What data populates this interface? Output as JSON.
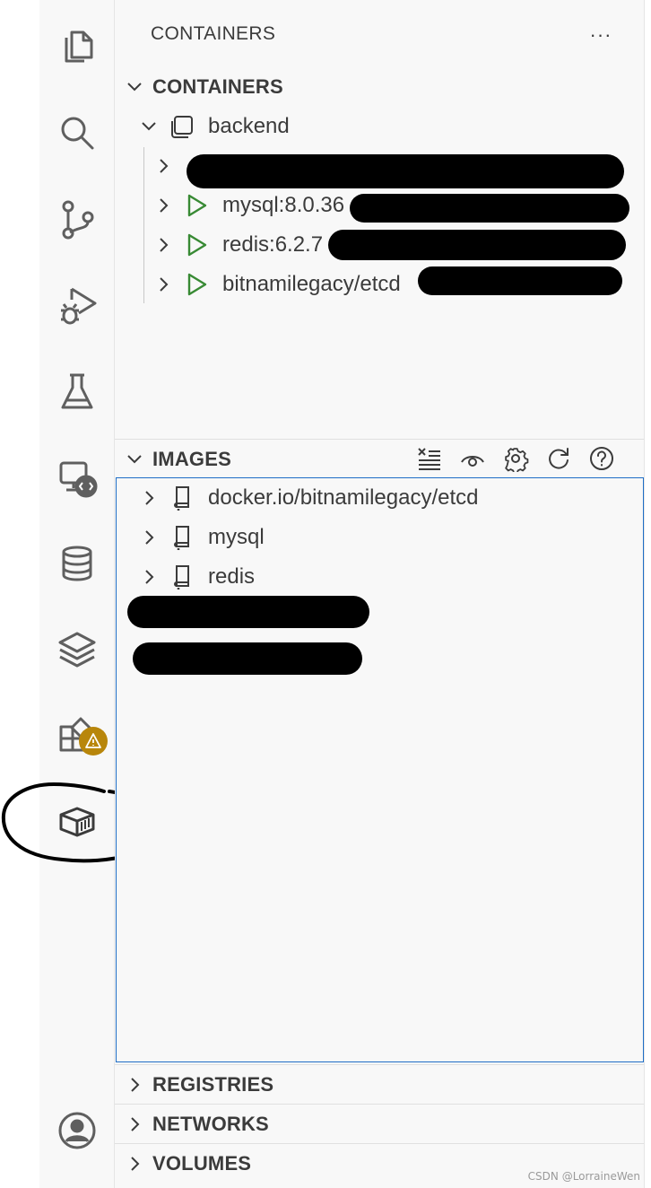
{
  "activity_bar": {
    "icons": [
      "explorer-icon",
      "search-icon",
      "source-control-icon",
      "run-debug-icon",
      "testing-icon",
      "remote-explorer-icon",
      "database-icon",
      "layers-icon",
      "extensions-icon",
      "docker-icon",
      "account-icon"
    ],
    "extensions_badge": "warning"
  },
  "sidebar": {
    "title": "CONTAINERS",
    "more_label": "···"
  },
  "containers_section": {
    "title": "CONTAINERS",
    "group": {
      "label": "backend"
    },
    "items": [
      {
        "label": ""
      },
      {
        "label": "mysql:8.0.36"
      },
      {
        "label": "redis:6.2.7"
      },
      {
        "label": "bitnamilegacy/etcd"
      }
    ]
  },
  "images_section": {
    "title": "IMAGES",
    "toolbar": [
      "clear-list-icon",
      "eye-icon",
      "gear-icon",
      "refresh-icon",
      "help-icon"
    ],
    "items": [
      {
        "label": "docker.io/bitnamilegacy/etcd"
      },
      {
        "label": "mysql"
      },
      {
        "label": "redis"
      }
    ]
  },
  "collapsed_sections": [
    {
      "title": "REGISTRIES"
    },
    {
      "title": "NETWORKS"
    },
    {
      "title": "VOLUMES"
    }
  ],
  "watermark": "CSDN @LorraineWen",
  "colors": {
    "run_green": "#388a34",
    "focus_blue": "#1f6ec6",
    "badge_amber": "#b8860b"
  }
}
